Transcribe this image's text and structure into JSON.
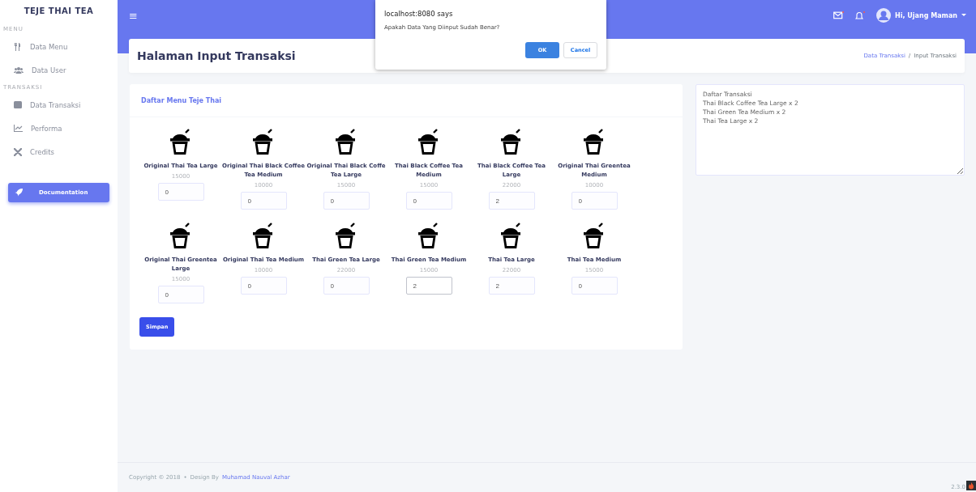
{
  "sidebar": {
    "brand": "TEJE THAI TEA",
    "sections": [
      {
        "heading": "MENU",
        "items": [
          {
            "label": "Data Menu"
          },
          {
            "label": "Data User"
          }
        ]
      },
      {
        "heading": "TRANSAKSI",
        "items": [
          {
            "label": "Data Transaksi"
          },
          {
            "label": "Performa"
          },
          {
            "label": "Credits"
          }
        ]
      }
    ],
    "button": "Documentation"
  },
  "topbar": {
    "menu_glyph": "≡",
    "user": "Hi, Ujang Maman"
  },
  "dialog": {
    "title": "localhost:8080 says",
    "message": "Apakah Data Yang Diinput Sudah Benar?",
    "ok": "OK",
    "cancel": "Cancel"
  },
  "header": {
    "title": "Halaman Input Transaksi",
    "breadcrumbs": [
      {
        "label": "Data Transaksi",
        "link": true
      },
      {
        "label": "Input Transaksi",
        "link": false
      }
    ],
    "separator": "/"
  },
  "menu_card": {
    "title": "Daftar Menu Teje Thai",
    "save_button": "Simpan",
    "items": [
      {
        "name": "Original Thai Tea Large",
        "price": "15000",
        "qty": "0",
        "focused": false
      },
      {
        "name": "Original Thai Black Coffee Tea Medium",
        "price": "10000",
        "qty": "0",
        "focused": false
      },
      {
        "name": "Original Thai Black Coffe Tea Large",
        "price": "15000",
        "qty": "0",
        "focused": false
      },
      {
        "name": "Thai Black Coffee Tea Medium",
        "price": "15000",
        "qty": "0",
        "focused": false
      },
      {
        "name": "Thai Black Coffee Tea Large",
        "price": "22000",
        "qty": "2",
        "focused": false
      },
      {
        "name": "Original Thai Greentea Medium",
        "price": "10000",
        "qty": "0",
        "focused": false
      },
      {
        "name": "Original Thai Greentea Large",
        "price": "15000",
        "qty": "0",
        "focused": false
      },
      {
        "name": "Original Thai Tea Medium",
        "price": "10000",
        "qty": "0",
        "focused": false
      },
      {
        "name": "Thai Green Tea Large",
        "price": "22000",
        "qty": "0",
        "focused": false
      },
      {
        "name": "Thai Green Tea Medium",
        "price": "15000",
        "qty": "2",
        "focused": true
      },
      {
        "name": "Thai Tea Large",
        "price": "22000",
        "qty": "2",
        "focused": false
      },
      {
        "name": "Thai Tea Medium",
        "price": "15000",
        "qty": "0",
        "focused": false
      }
    ]
  },
  "transaction_box": {
    "lines": [
      "Daftar Transaksi",
      "Thai Black Coffee Tea Large x 2",
      "Thai Green Tea Medium x 2",
      "Thai Tea Large x 2"
    ]
  },
  "footer": {
    "copyright": "Copyright © 2018",
    "bullet": "•",
    "design_by": "Design By",
    "author": "Muhamad Nauval Azhar",
    "version": "2.3.0"
  }
}
